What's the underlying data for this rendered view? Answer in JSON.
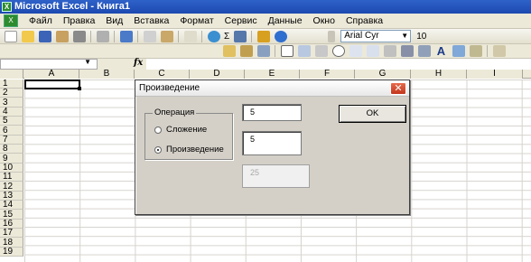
{
  "window": {
    "title": "Microsoft Excel - Книга1"
  },
  "menu": {
    "items": [
      "Файл",
      "Правка",
      "Вид",
      "Вставка",
      "Формат",
      "Сервис",
      "Данные",
      "Окно",
      "Справка"
    ]
  },
  "toolbar": {
    "font_name": "Arial Cyr",
    "font_size": "10",
    "sigma": "Σ"
  },
  "formula_bar": {
    "fx_label": "fx",
    "name_box": "",
    "content": ""
  },
  "sheet": {
    "columns": [
      "A",
      "B",
      "C",
      "D",
      "E",
      "F",
      "G",
      "H",
      "I"
    ],
    "rows": [
      "1",
      "2",
      "3",
      "4",
      "5",
      "6",
      "7",
      "8",
      "9",
      "10",
      "11",
      "12",
      "13",
      "14",
      "15",
      "16",
      "17",
      "18",
      "19"
    ],
    "active_cell": "A1"
  },
  "dialog": {
    "title": "Произведение",
    "close_symbol": "✕",
    "group_label": "Операция",
    "options": [
      {
        "label": "Сложение",
        "selected": false
      },
      {
        "label": "Произведение",
        "selected": true
      }
    ],
    "input1": "5",
    "input2": "5",
    "result": "25",
    "ok_label": "OK"
  }
}
